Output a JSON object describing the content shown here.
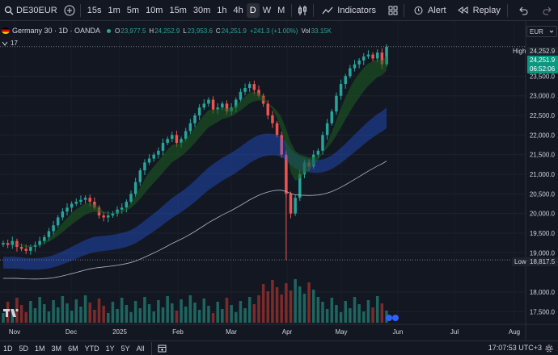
{
  "toolbar": {
    "symbol": "DE30EUR",
    "timeframes": [
      "15s",
      "1m",
      "5m",
      "10m",
      "15m",
      "30m",
      "1h",
      "4h",
      "D",
      "W",
      "M"
    ],
    "active_timeframe": "D",
    "indicators_label": "Indicators",
    "alert_label": "Alert",
    "replay_label": "Replay"
  },
  "legend": {
    "title": "Germany 30 · 1D · OANDA",
    "open_label": "O",
    "open": "23,977.5",
    "high_label": "H",
    "high": "24,252.9",
    "low_label": "L",
    "low": "23,953.6",
    "close_label": "C",
    "close": "24,251.9",
    "change": "+241.3 (+1.00%)",
    "vol_label": "Vol",
    "vol": "33.15K",
    "indicator_count": "17"
  },
  "price_scale": {
    "currency": "EUR",
    "high_label": "High",
    "high_value": "24,252.9",
    "current_price": "24,251.9",
    "countdown": "06:52:06",
    "low_label": "Low",
    "low_value": "18,817.5",
    "ticks": [
      "23,500.0",
      "23,000.0",
      "22,500.0",
      "22,000.0",
      "21,500.0",
      "21,000.0",
      "20,500.0",
      "20,000.0",
      "19,500.0",
      "19,000.0",
      "18,000.0",
      "17,500.0"
    ]
  },
  "time_axis": {
    "labels": [
      "Nov",
      "Dec",
      "2025",
      "Feb",
      "Mar",
      "Apr",
      "May",
      "Jun",
      "Jul",
      "Aug"
    ]
  },
  "bottombar": {
    "ranges": [
      "1D",
      "5D",
      "1M",
      "3M",
      "6M",
      "YTD",
      "1Y",
      "5Y",
      "All"
    ],
    "clock": "17:07:53 UTC+3"
  },
  "colors": {
    "background": "#131722",
    "up": "#26a69a",
    "down": "#ef5350",
    "accent": "#2962ff"
  },
  "chart_data": {
    "type": "candlestick",
    "title": "Germany 30 · 1D · OANDA",
    "y_range": [
      17300,
      24700
    ],
    "x_labels": [
      "Nov",
      "Dec",
      "2025",
      "Feb",
      "Mar",
      "Apr",
      "May",
      "Jun",
      "Jul",
      "Aug"
    ],
    "close_series_approx": [
      19250,
      19200,
      19300,
      19150,
      19100,
      19050,
      19150,
      19200,
      19300,
      19400,
      19550,
      19700,
      19900,
      20050,
      20150,
      20250,
      20300,
      20350,
      20400,
      20300,
      20150,
      19950,
      19900,
      19950,
      20000,
      20100,
      20150,
      20300,
      20500,
      20800,
      21100,
      21300,
      21400,
      21500,
      21600,
      21800,
      21900,
      22000,
      21800,
      21900,
      22100,
      22300,
      22500,
      22700,
      22800,
      22900,
      22650,
      22700,
      22800,
      22600,
      22700,
      22900,
      23100,
      23200,
      23300,
      23150,
      23000,
      22800,
      22500,
      22300,
      22000,
      21500,
      20500,
      20000,
      20400,
      21000,
      21300,
      21200,
      21500,
      21600,
      22000,
      22300,
      22600,
      23000,
      23300,
      23500,
      23700,
      23800,
      23900,
      24000,
      24050,
      23950,
      24100,
      23800,
      24251.9
    ],
    "note_price_high": 24252.9,
    "note_price_low": 18817.5
  }
}
